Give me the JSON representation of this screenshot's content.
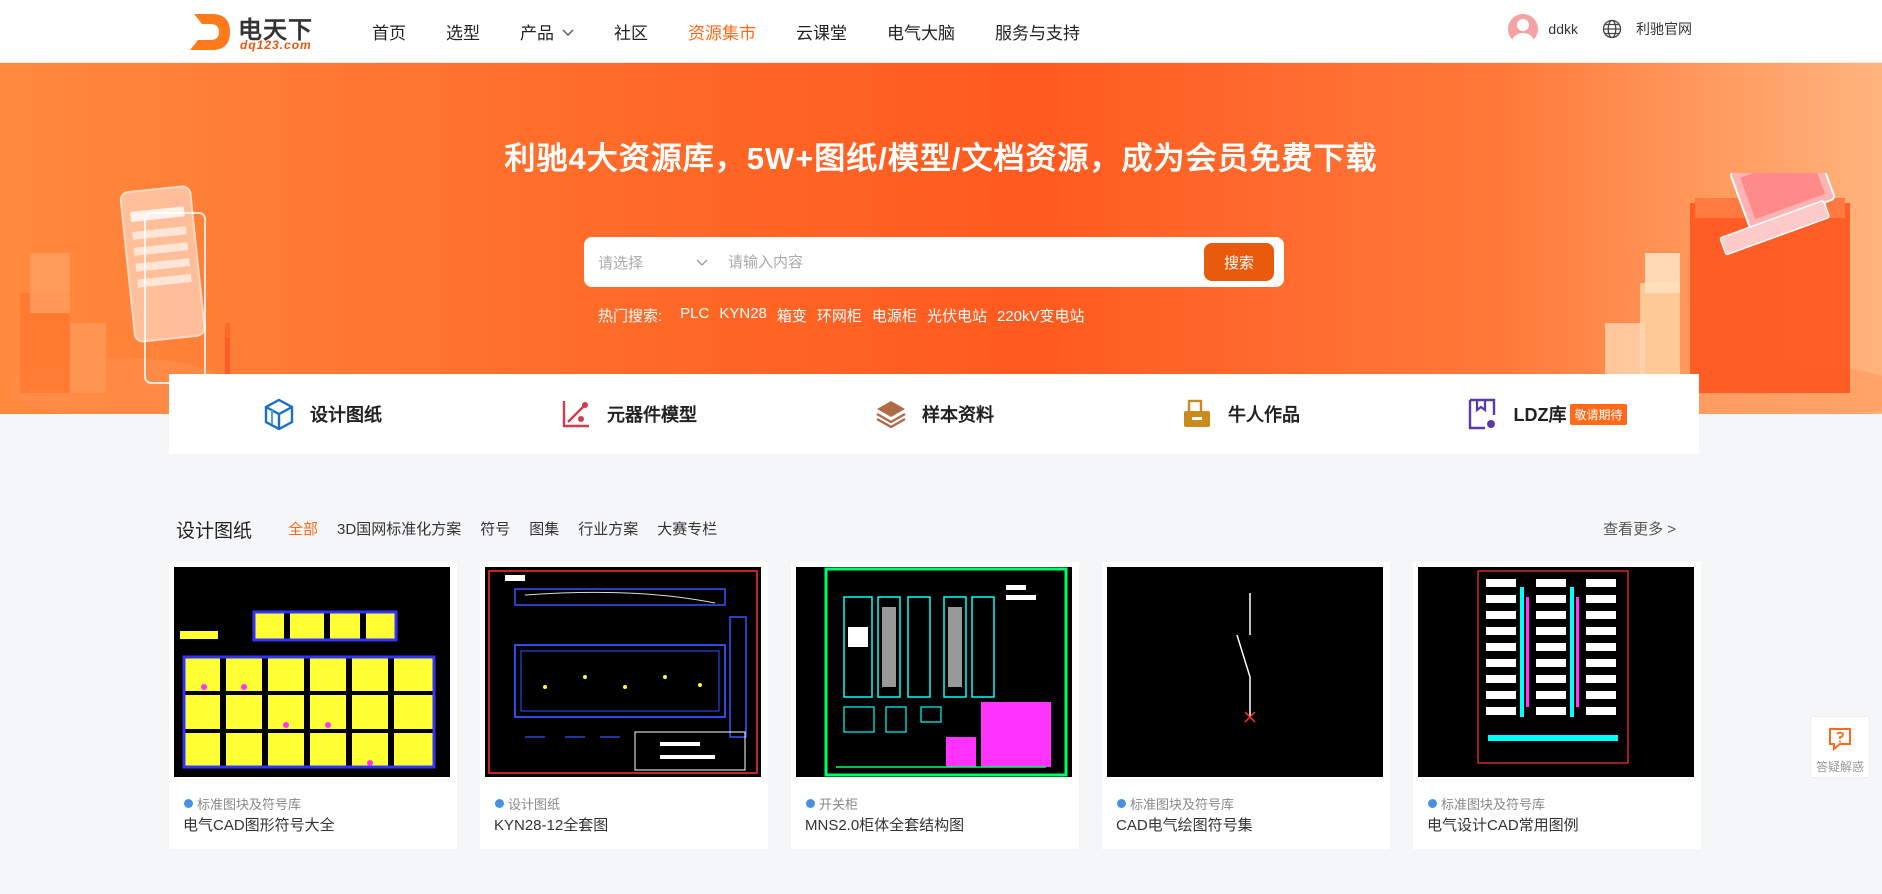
{
  "header": {
    "logo_cn": "电天下",
    "logo_en": "dq123.com",
    "nav": [
      {
        "label": "首页",
        "active": false
      },
      {
        "label": "选型",
        "active": false
      },
      {
        "label": "产品",
        "active": false,
        "dropdown": true
      },
      {
        "label": "社区",
        "active": false
      },
      {
        "label": "资源集市",
        "active": true
      },
      {
        "label": "云课堂",
        "active": false
      },
      {
        "label": "电气大脑",
        "active": false
      },
      {
        "label": "服务与支持",
        "active": false
      }
    ],
    "username": "ddkk",
    "site_link": "利驰官网"
  },
  "hero": {
    "title": "利驰4大资源库，5W+图纸/模型/文档资源，成为会员免费下载",
    "select_placeholder": "请选择",
    "search_placeholder": "请输入内容",
    "search_button": "搜索",
    "hot_label": "热门搜索:",
    "hot_items": [
      "PLC",
      "KYN28",
      "箱变",
      "环网柜",
      "电源柜",
      "光伏电站",
      "220kV变电站"
    ]
  },
  "categories": [
    {
      "label": "设计图纸",
      "icon": "cube-icon"
    },
    {
      "label": "元器件模型",
      "icon": "component-icon"
    },
    {
      "label": "样本资料",
      "icon": "layers-icon"
    },
    {
      "label": "牛人作品",
      "icon": "works-icon"
    },
    {
      "label": "LDZ库",
      "icon": "library-icon",
      "badge": "敬请期待"
    }
  ],
  "section": {
    "title": "设计图纸",
    "filters": [
      {
        "label": "全部",
        "active": true
      },
      {
        "label": "3D国网标准化方案",
        "active": false
      },
      {
        "label": "符号",
        "active": false
      },
      {
        "label": "图集",
        "active": false
      },
      {
        "label": "行业方案",
        "active": false
      },
      {
        "label": "大赛专栏",
        "active": false
      }
    ],
    "more": "查看更多 >"
  },
  "cards": [
    {
      "tag": "标准图块及符号库",
      "title": "电气CAD图形符号大全"
    },
    {
      "tag": "设计图纸",
      "title": "KYN28-12全套图"
    },
    {
      "tag": "开关柜",
      "title": "MNS2.0柜体全套结构图"
    },
    {
      "tag": "标准图块及符号库",
      "title": "CAD电气绘图符号集"
    },
    {
      "tag": "标准图块及符号库",
      "title": "电气设计CAD常用图例"
    }
  ],
  "float_button": {
    "label": "答疑解惑"
  },
  "colors": {
    "accent": "#ff6a1a",
    "button": "#e85a0c",
    "tag_dot": "#4a90e2"
  }
}
